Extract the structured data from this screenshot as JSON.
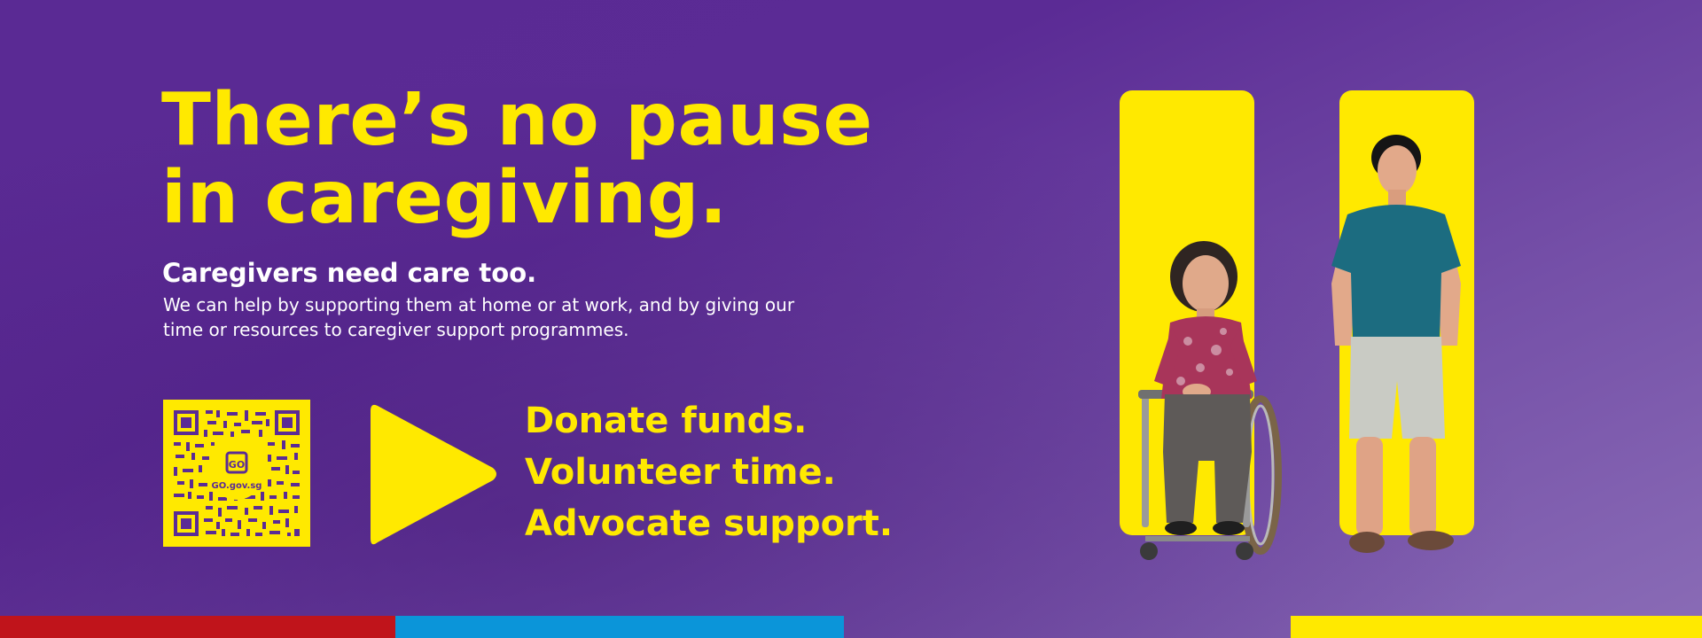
{
  "headline": {
    "line1": "There’s no pause",
    "line2": "in caregiving."
  },
  "subheading": "Caregivers need care too.",
  "body": "We can help by supporting them at home or at work, and by giving our time or resources to caregiver support programmes.",
  "qr": {
    "logo_mark": "GO",
    "logo_text": "GO.gov.sg"
  },
  "cta": {
    "line1": "Donate funds.",
    "line2": "Volunteer time.",
    "line3": "Advocate support."
  },
  "icons": [
    "qr-code-icon",
    "play-arrow-icon"
  ],
  "colors": {
    "background": "#5a2a94",
    "accent_yellow": "#ffe900",
    "white": "#ffffff",
    "band_red": "#c0141b",
    "band_blue": "#0b95d9",
    "band_yellow": "#ffe900"
  }
}
